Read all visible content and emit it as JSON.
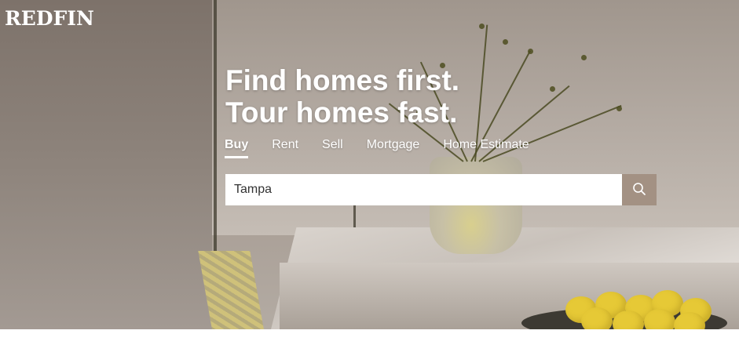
{
  "header": {
    "logo_text": "REDFIN"
  },
  "hero": {
    "headline_line1": "Find homes first.",
    "headline_line2": "Tour homes fast."
  },
  "tabs": [
    {
      "label": "Buy",
      "active": true
    },
    {
      "label": "Rent",
      "active": false
    },
    {
      "label": "Sell",
      "active": false
    },
    {
      "label": "Mortgage",
      "active": false
    },
    {
      "label": "Home Estimate",
      "active": false
    }
  ],
  "search": {
    "value": "Tampa",
    "button_icon": "search-icon"
  },
  "colors": {
    "search_button": "#a39183",
    "text_on_hero": "#ffffff"
  }
}
